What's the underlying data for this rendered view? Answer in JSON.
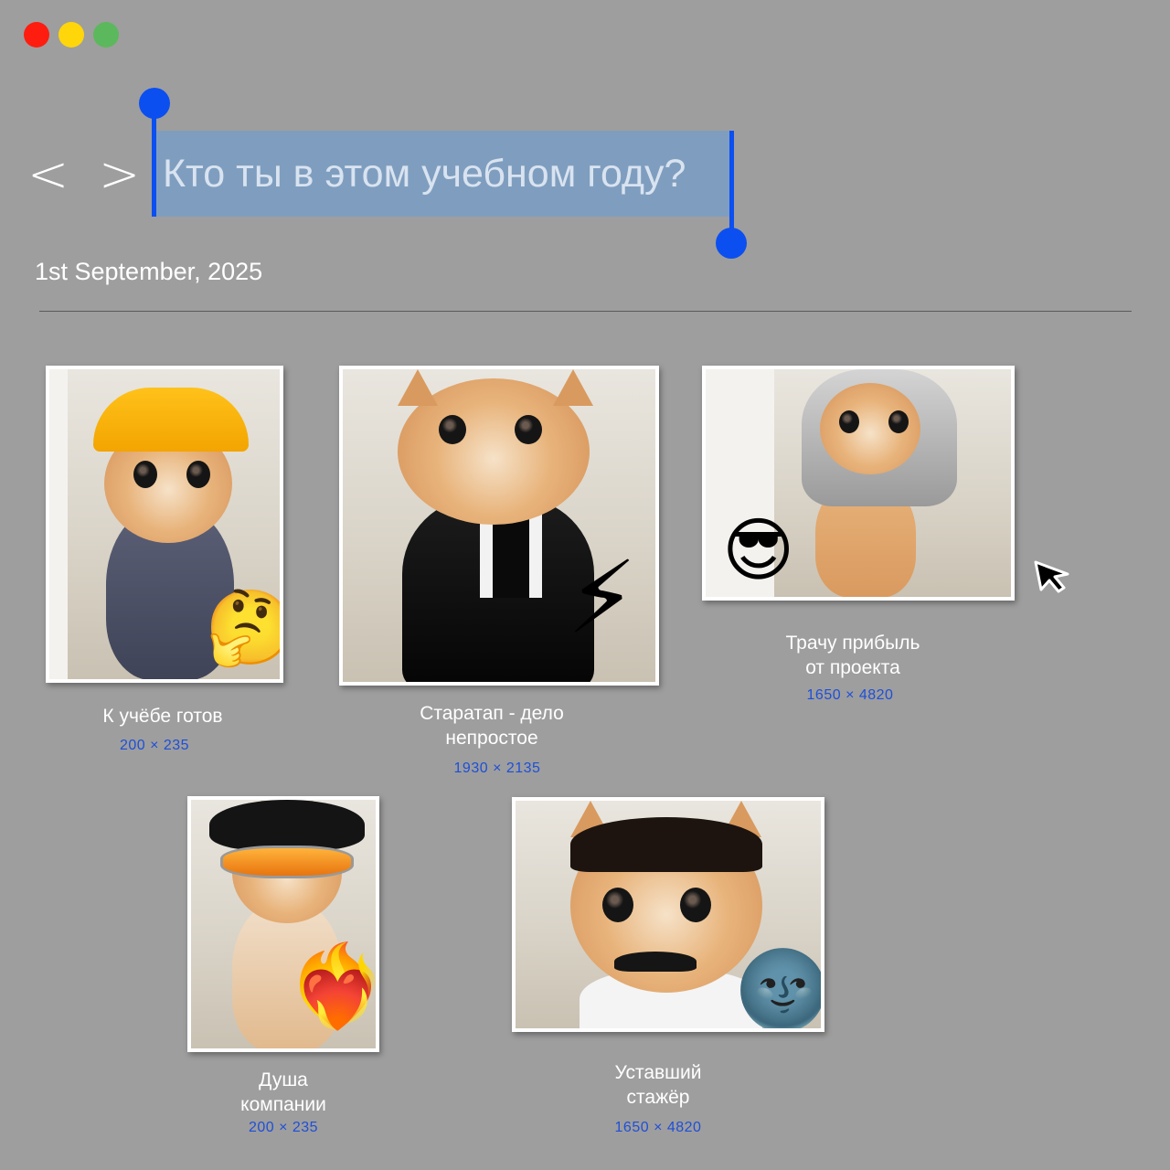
{
  "window_controls": {
    "close": {
      "color": "#ff1d10"
    },
    "minimize": {
      "color": "#ffd60a"
    },
    "zoom": {
      "color": "#5cb85c"
    }
  },
  "nav": {
    "back": "<",
    "forward": ">"
  },
  "title": "Кто ты в этом учебном году?",
  "date": "1st September, 2025",
  "selection_color": "#0c4ff0",
  "cards": [
    {
      "caption_lines": [
        "К учёбе готов"
      ],
      "dims": "200 × 235",
      "emoji": "🤔",
      "costume": "hard hat and work jacket"
    },
    {
      "caption_lines": [
        "Старатап - дело",
        "непростое"
      ],
      "dims": "1930 × 2135",
      "emoji": "⚡",
      "costume": "black suit"
    },
    {
      "caption_lines": [
        "Трачу прибыль",
        "от проекта"
      ],
      "dims": "1650 × 4820",
      "emoji": "😎",
      "costume": "ghutra headdress"
    },
    {
      "caption_lines": [
        "Душа",
        "компании"
      ],
      "dims": "200 × 235",
      "emoji": "❤️‍🔥",
      "costume": "afro and sunglasses"
    },
    {
      "caption_lines": [
        "Уставший",
        "стажёр"
      ],
      "dims": "1650 × 4820",
      "emoji": "🌚",
      "costume": "black wig and mustache"
    }
  ]
}
